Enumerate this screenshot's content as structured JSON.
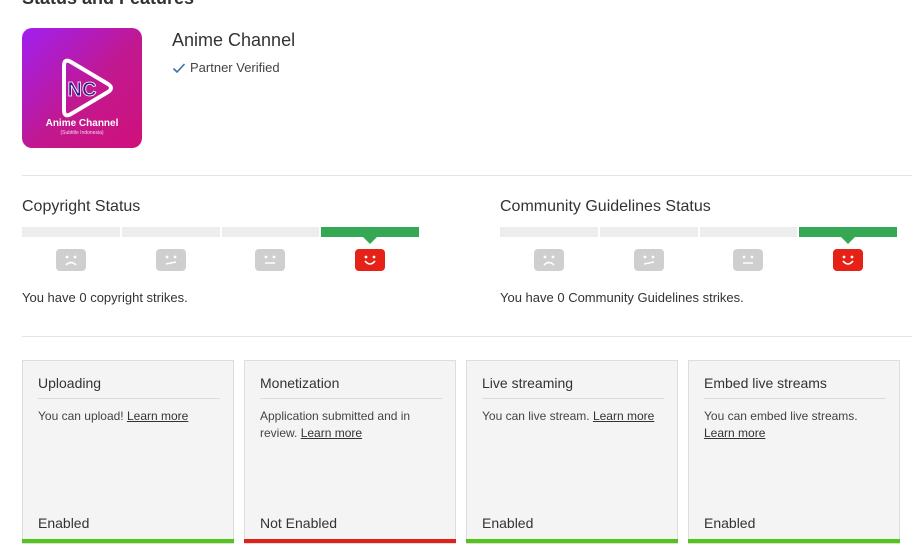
{
  "page": {
    "heading": "Status and Features"
  },
  "channel": {
    "name": "Anime Channel",
    "verified_label": "Partner Verified",
    "logo_title": "Anime Channel",
    "logo_subtitle": "(Subtitle Indonesia)",
    "logo_monogram": "NC"
  },
  "copyright": {
    "title": "Copyright Status",
    "message": "You have 0 copyright strikes.",
    "active_segment": 4
  },
  "community": {
    "title": "Community Guidelines Status",
    "message": "You have 0 Community Guidelines strikes.",
    "active_segment": 4
  },
  "features": [
    {
      "title": "Uploading",
      "text": "You can upload! ",
      "link": "Learn more",
      "status": "Enabled",
      "color": "#52c41a"
    },
    {
      "title": "Monetization",
      "text": "Application submitted and in review. ",
      "link": "Learn more",
      "status": "Not Enabled",
      "color": "#e0201a"
    },
    {
      "title": "Live streaming",
      "text": "You can live stream. ",
      "link": "Learn more",
      "status": "Enabled",
      "color": "#52c41a"
    },
    {
      "title": "Embed live streams",
      "text": "You can embed live streams. ",
      "link": "Learn more",
      "status": "Enabled",
      "color": "#52c41a"
    }
  ],
  "colors": {
    "strike_ok": "#34a853",
    "happy_face": "#e62117",
    "neutral_face": "#cfcfcf"
  }
}
